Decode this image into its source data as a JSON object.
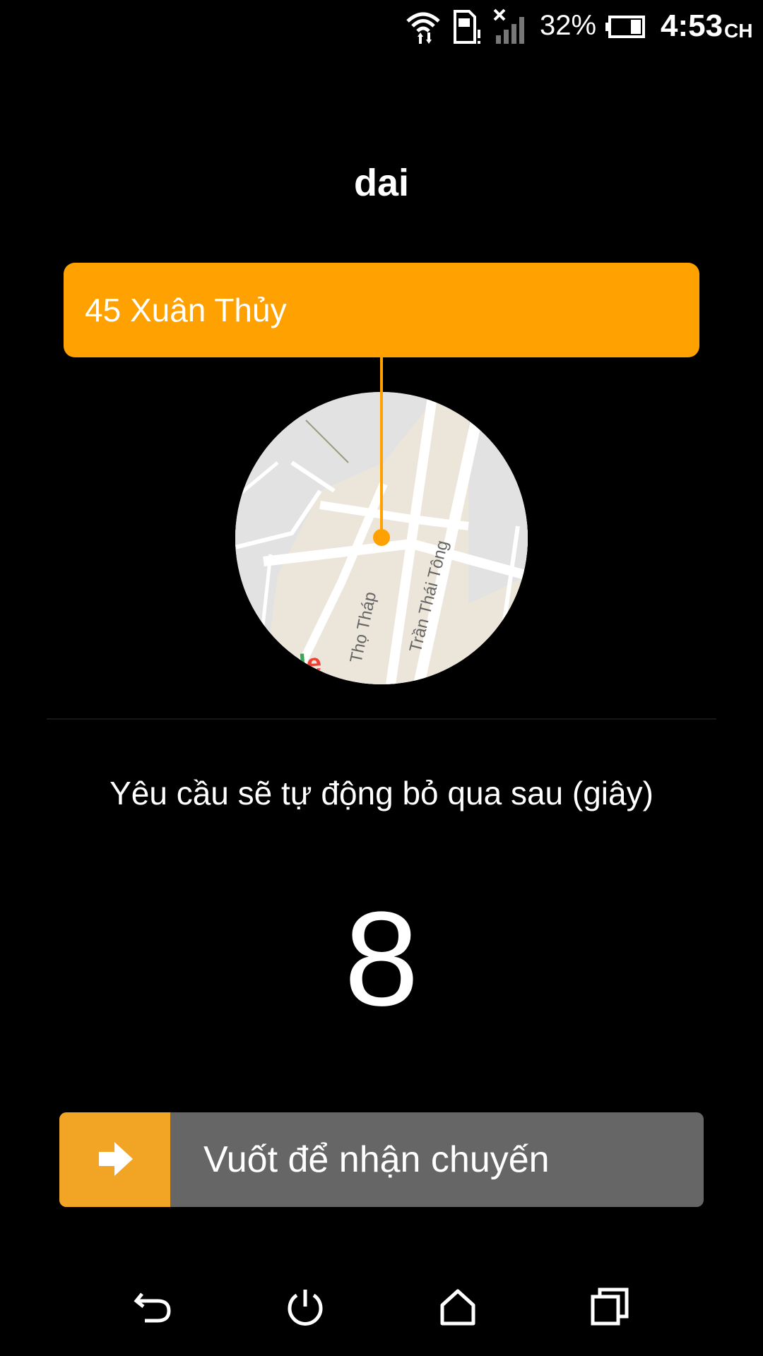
{
  "status_bar": {
    "battery_percent": "32%",
    "time": "4:53",
    "ampm": "CH",
    "icons": [
      "wifi-data-icon",
      "sim-alert-icon",
      "signal-off-icon",
      "battery-icon"
    ]
  },
  "title": "dai",
  "pickup": {
    "address": "45 Xuân Thủy"
  },
  "map": {
    "street_labels": [
      "Thọ Tháp",
      "Trần Thái Tông"
    ],
    "logo_text": "gle"
  },
  "auto_skip_label": "Yêu cầu sẽ tự động bỏ qua sau (giây)",
  "countdown": "8",
  "swipe": {
    "label": "Vuốt để nhận chuyến",
    "icon": "arrow-right-icon"
  },
  "navbar": {
    "items": [
      "back-icon",
      "power-icon",
      "home-icon",
      "recents-icon"
    ]
  },
  "colors": {
    "accent": "#FFA100",
    "swipe_handle": "#F2A524",
    "swipe_track": "#666666",
    "background": "#000000"
  }
}
